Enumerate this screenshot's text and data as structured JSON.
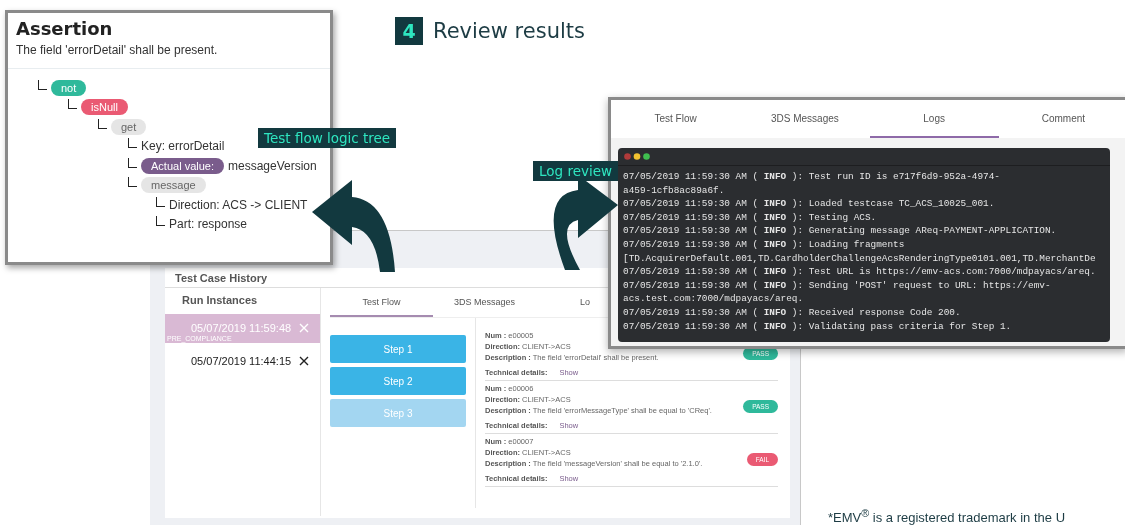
{
  "heading": {
    "step": "4",
    "title": "Review results"
  },
  "assertion": {
    "title": "Assertion",
    "subtitle": "The field 'errorDetail' shall be present.",
    "tree": [
      {
        "kind": "pill",
        "label": "not",
        "color": "#2fb99b",
        "children": [
          {
            "kind": "pill",
            "label": "isNull",
            "color": "#ea5a73",
            "children": [
              {
                "kind": "chip",
                "label": "get",
                "children": [
                  {
                    "kind": "text",
                    "label": "Key: errorDetail"
                  },
                  {
                    "kind": "pill",
                    "label": "Actual value:",
                    "color": "#7a5c8c",
                    "value": "messageVersion"
                  },
                  {
                    "kind": "chip",
                    "label": "message",
                    "children": [
                      {
                        "kind": "text",
                        "label": "Direction: ACS -> CLIENT"
                      },
                      {
                        "kind": "text",
                        "label": "Part: response"
                      }
                    ]
                  }
                ]
              }
            ]
          }
        ]
      }
    ]
  },
  "callouts": [
    "Test flow logic tree",
    "Log review"
  ],
  "history": {
    "title": "Test Case History",
    "runs_title": "Run Instances",
    "runs": [
      {
        "time": "05/07/2019 11:59:48",
        "tag": "PRE_COMPLIANCE",
        "selected": true
      },
      {
        "time": "05/07/2019 11:44:15",
        "selected": false
      }
    ],
    "tabs": [
      {
        "label": "Test Flow",
        "selected": true
      },
      {
        "label": "3DS Messages",
        "selected": false
      },
      {
        "label": "Lo",
        "selected": false
      }
    ],
    "steps": [
      {
        "label": "Step 1",
        "disabled": false
      },
      {
        "label": "Step 2",
        "disabled": false
      },
      {
        "label": "Step 3",
        "disabled": true
      }
    ],
    "messages": [
      {
        "fields": [
          "**Num :** e00005",
          "**Direction:** CLIENT->ACS",
          "**Description :** The field 'errorDetail' shall be present."
        ],
        "details_label": "Technical details:",
        "details_link": "Show",
        "status": {
          "kind": "pass",
          "label": "PASS"
        }
      },
      {
        "fields": [
          "**Num :** e00006",
          "**Direction:** CLIENT->ACS",
          "**Description :** The field 'errorMessageType' shall be equal to 'CReq'."
        ],
        "details_label": "Technical details:",
        "details_link": "Show",
        "status": {
          "kind": "pass",
          "label": "PASS"
        }
      },
      {
        "fields": [
          "**Num :** e00007",
          "**Direction:** CLIENT->ACS",
          "**Description :** The field 'messageVersion' shall be equal to '2.1.0'."
        ],
        "details_label": "Technical details:",
        "details_link": "Show",
        "status": {
          "kind": "fail",
          "label": "FAIL"
        }
      }
    ]
  },
  "logs": {
    "tabs": [
      {
        "label": "Test Flow",
        "selected": false
      },
      {
        "label": "3DS Messages",
        "selected": false
      },
      {
        "label": "Logs",
        "selected": true
      },
      {
        "label": "Comment",
        "selected": false
      }
    ],
    "lines": [
      "07/05/2019 11:59:30 AM ( **INFO** ): Test run ID is e717f6d9-952a-4974-",
      "a459-1cfb8ac89a6f.",
      "07/05/2019 11:59:30 AM ( **INFO** ): Loaded testcase TC_ACS_10025_001.",
      "07/05/2019 11:59:30 AM ( **INFO** ): Testing ACS.",
      "07/05/2019 11:59:30 AM ( **INFO** ): Generating message AReq-PAYMENT-APPLICATION.",
      "07/05/2019 11:59:30 AM ( **INFO** ): Loading fragments",
      "[TD.AcquirerDefault.001,TD.CardholderChallengeAcsRenderingType0101.001,TD.MerchantDe",
      "07/05/2019 11:59:30 AM ( **INFO** ): Test URL is https://emv-acs.com:7000/mdpayacs/areq.",
      "07/05/2019 11:59:30 AM ( **INFO** ): Sending 'POST' request to URL: https://emv-",
      "acs.test.com:7000/mdpayacs/areq.",
      "07/05/2019 11:59:30 AM ( **INFO** ): Received response Code 200.",
      "07/05/2019 11:59:30 AM ( **INFO** ): Validating pass criteria for Step 1."
    ]
  },
  "footnote": "*EMV$^{®}$ is a registered trademark in the U"
}
